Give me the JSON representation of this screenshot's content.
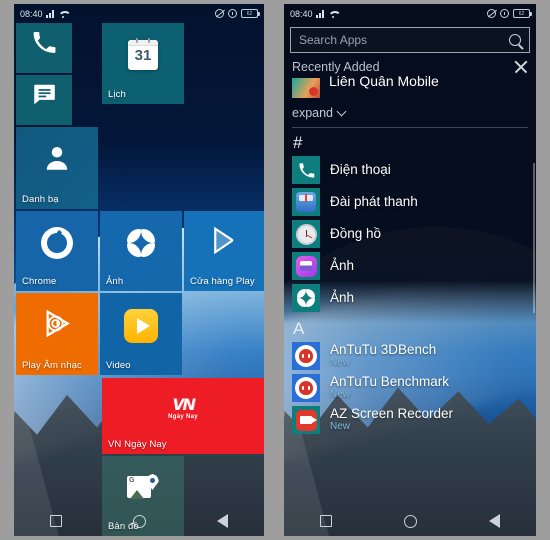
{
  "statusbar": {
    "time": "08:40",
    "signal_icon": "signal-bars-icon",
    "wifi_icon": "wifi-icon",
    "dnd_icon": "do-not-disturb-icon",
    "alarm_icon": "alarm-icon",
    "battery_level": "62"
  },
  "home": {
    "tiles": [
      {
        "label": "",
        "icon": "phone-icon",
        "color": "#0f5f6e"
      },
      {
        "label": "",
        "icon": "message-icon",
        "color": "#0f5f6e"
      },
      {
        "label": "Lịch",
        "icon": "calendar-icon",
        "color": "#0d5f72"
      },
      {
        "label": "Danh bạ",
        "icon": "contacts-icon",
        "color": "#125d85"
      },
      {
        "label": "Chrome",
        "icon": "chrome-icon",
        "color": "#1565a8"
      },
      {
        "label": "Ảnh",
        "icon": "photos-pinwheel-icon",
        "color": "#1668ad"
      },
      {
        "label": "Cửa hàng Play",
        "icon": "play-store-icon",
        "color": "#1672b8"
      },
      {
        "label": "Play Âm nhạc",
        "icon": "play-music-icon",
        "color": "#ef6c00"
      },
      {
        "label": "Video",
        "icon": "video-icon",
        "color": "#1164a6"
      },
      {
        "label": "VN Ngày Nay",
        "icon": "vn-ngay-nay-icon",
        "color": "#ee1c25"
      },
      {
        "label": "Bản đồ",
        "icon": "maps-icon",
        "color": "rgba(60,120,110,0.55)"
      }
    ],
    "vn_logo": {
      "word": "VN",
      "sub": "Ngày Nay"
    },
    "calendar_day": "31",
    "navbar": {
      "recents_icon": "recents-square-icon",
      "home_icon": "home-circle-icon",
      "back_icon": "back-triangle-icon"
    }
  },
  "drawer": {
    "search": {
      "placeholder": "Search Apps",
      "value": "",
      "icon": "search-icon"
    },
    "recently_added": {
      "title": "Recently Added",
      "close_icon": "close-icon",
      "item": {
        "name": "Liên Quân Mobile",
        "icon": "lien-quan-mobile-icon"
      },
      "expand_label": "expand",
      "expand_icon": "chevron-down-icon"
    },
    "sections": [
      {
        "header": "#",
        "apps": [
          {
            "name": "Điện thoại",
            "sub": "",
            "icon": "phone-icon"
          },
          {
            "name": "Đài phát thanh",
            "sub": "",
            "icon": "radio-icon"
          },
          {
            "name": "Đồng hồ",
            "sub": "",
            "icon": "clock-icon"
          },
          {
            "name": "Ảnh",
            "sub": "",
            "icon": "gallery-icon"
          },
          {
            "name": "Ảnh",
            "sub": "",
            "icon": "photos-pinwheel-icon"
          }
        ]
      },
      {
        "header": "A",
        "apps": [
          {
            "name": "AnTuTu 3DBench",
            "sub": "New",
            "icon": "antutu-3d-icon"
          },
          {
            "name": "AnTuTu Benchmark",
            "sub": "New",
            "icon": "antutu-icon"
          },
          {
            "name": "AZ Screen Recorder",
            "sub": "New",
            "icon": "az-screen-recorder-icon"
          }
        ]
      }
    ],
    "navbar": {
      "recents_icon": "recents-square-icon",
      "home_icon": "home-circle-icon",
      "back_icon": "back-triangle-icon"
    }
  }
}
